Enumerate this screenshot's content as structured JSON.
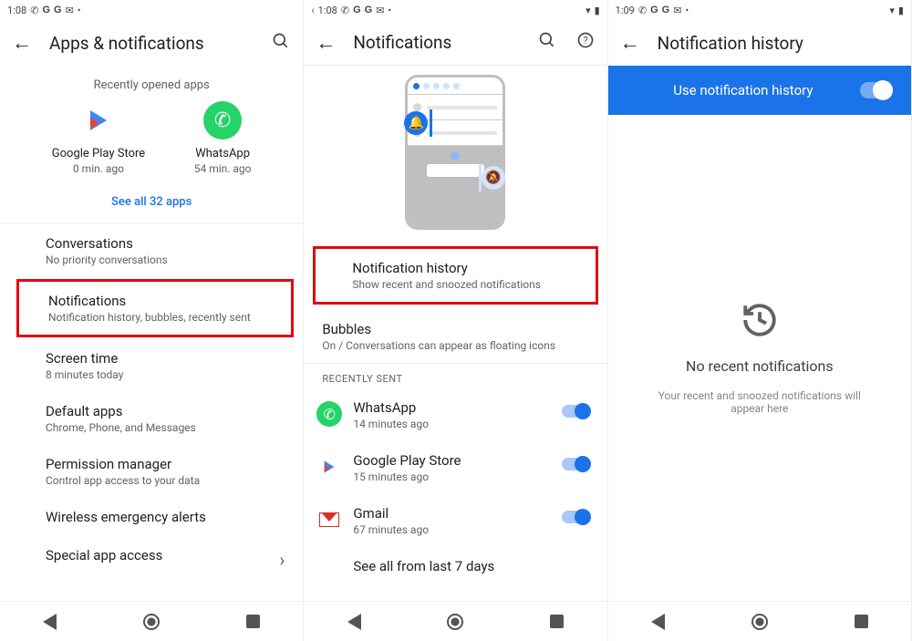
{
  "panel1": {
    "status": {
      "time": "1:08"
    },
    "header": {
      "title": "Apps & notifications"
    },
    "recently_opened_label": "Recently opened apps",
    "apps": [
      {
        "name": "Google Play Store",
        "sub": "0 min. ago"
      },
      {
        "name": "WhatsApp",
        "sub": "54 min. ago"
      }
    ],
    "see_all": "See all 32 apps",
    "rows": {
      "conversations": {
        "title": "Conversations",
        "sub": "No priority conversations"
      },
      "notifications": {
        "title": "Notifications",
        "sub": "Notification history, bubbles, recently sent"
      },
      "screen_time": {
        "title": "Screen time",
        "sub": "8 minutes today"
      },
      "default_apps": {
        "title": "Default apps",
        "sub": "Chrome, Phone, and Messages"
      },
      "permission_manager": {
        "title": "Permission manager",
        "sub": "Control app access to your data"
      },
      "wireless_alerts": {
        "title": "Wireless emergency alerts"
      },
      "special_access": {
        "title": "Special app access"
      }
    }
  },
  "panel2": {
    "status": {
      "time": "1:08"
    },
    "header": {
      "title": "Notifications"
    },
    "notif_history": {
      "title": "Notification history",
      "sub": "Show recent and snoozed notifications"
    },
    "bubbles": {
      "title": "Bubbles",
      "sub": "On / Conversations can appear as floating icons"
    },
    "recently_sent_label": "RECENTLY SENT",
    "recent": [
      {
        "name": "WhatsApp",
        "sub": "14 minutes ago"
      },
      {
        "name": "Google Play Store",
        "sub": "15 minutes ago"
      },
      {
        "name": "Gmail",
        "sub": "67 minutes ago"
      }
    ],
    "see_all_days": "See all from last 7 days"
  },
  "panel3": {
    "status": {
      "time": "1:09"
    },
    "header": {
      "title": "Notification history"
    },
    "toggle_label": "Use notification history",
    "empty_title": "No recent notifications",
    "empty_sub": "Your recent and snoozed notifications will appear here"
  }
}
